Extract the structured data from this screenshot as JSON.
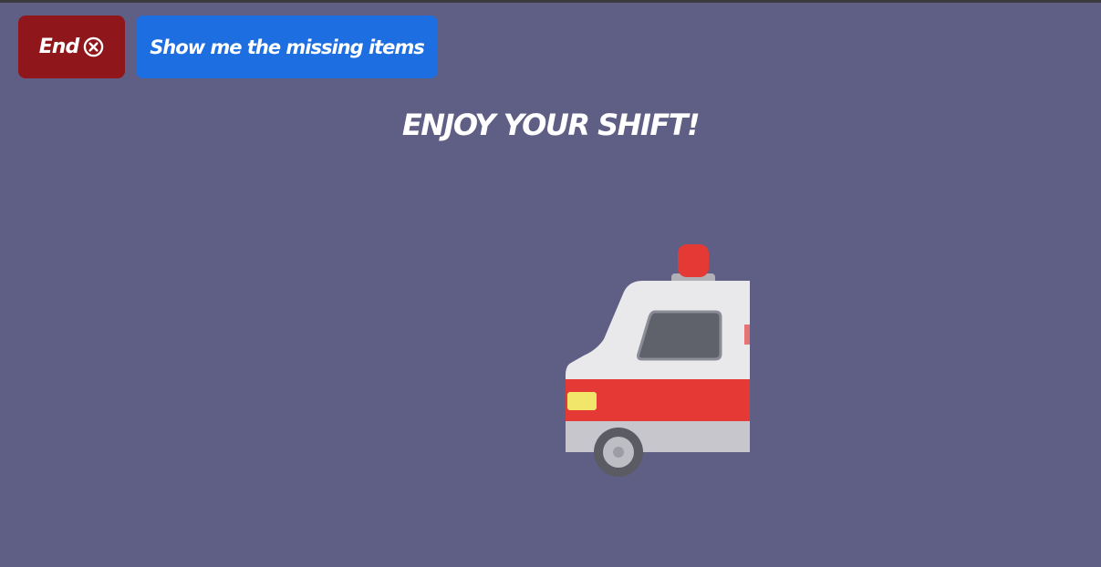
{
  "buttons": {
    "end_label": "End",
    "end_icon": "circle-x-icon",
    "missing_items_label": "Show me the missing items"
  },
  "main": {
    "headline": "ENJOY YOUR SHIFT!",
    "illustration": "ambulance-icon"
  },
  "colors": {
    "background": "#5f5e84",
    "end_button": "#8f171b",
    "missing_button": "#1d6ee0",
    "ambulance_stripe": "#e53935",
    "ambulance_body": "#e9e9ec"
  }
}
